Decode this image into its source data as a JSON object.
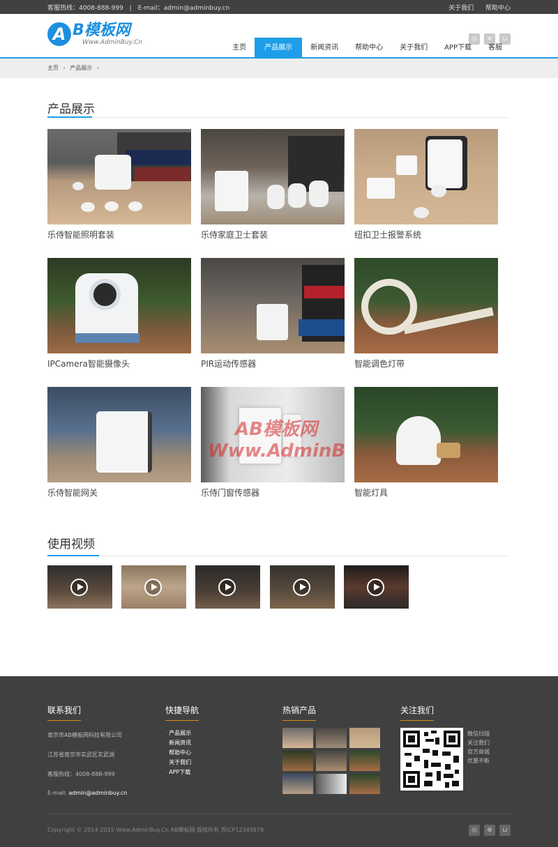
{
  "topbar": {
    "hotline": "客服热线：4008-888-999",
    "email": "E-mail：admin@adminbuy.cn",
    "links": [
      "关于我们",
      "帮助中心"
    ]
  },
  "logo": {
    "mark": "A",
    "brand": "B模板网",
    "site": "Www.AdminBuy.Cn"
  },
  "header_icons": [
    "weibo-icon",
    "doc-icon",
    "cart-icon"
  ],
  "nav": {
    "items": [
      "主页",
      "产品展示",
      "新闻资讯",
      "帮助中心",
      "关于我们",
      "APP下载",
      "客服"
    ],
    "active": "产品展示"
  },
  "breadcrumb": {
    "home": "主页",
    "current": "产品展示",
    "sep": "›"
  },
  "products": {
    "title": "产品展示",
    "items": [
      "乐侍智能照明套装",
      "乐侍家庭卫士套装",
      "纽扣卫士报警系统",
      "IPCamera智能摄像头",
      "PIR运动传感器",
      "智能调色灯带",
      "乐侍智能网关",
      "乐侍门窗传感器",
      "智能灯具"
    ]
  },
  "videos": {
    "title": "使用视频",
    "count": 5
  },
  "footer": {
    "contact": {
      "title": "联系我们",
      "company": "南京市AB模板网科技有限公司",
      "address": "江苏省南京市玄武区玄武湖",
      "hotline": "客服热线：4008-888-999",
      "email_label": "E-mail:",
      "email": "admin@adminbuy.cn"
    },
    "quicknav": {
      "title": "快捷导航",
      "items": [
        "产品展示",
        "新闻资讯",
        "帮助中心",
        "关于我们",
        "APP下载"
      ]
    },
    "hot": {
      "title": "热销产品"
    },
    "follow": {
      "title": "关注我们",
      "lines": [
        "微信扫描",
        "关注我们",
        "官方商城",
        "优惠不断"
      ]
    },
    "copyright": "Copyright © 2014-2015 Www.AdminBuy.Cn AB模板网 版权所有  苏ICP12345678"
  },
  "watermark": "AB模板网 Www.AdminBuy.Cn"
}
